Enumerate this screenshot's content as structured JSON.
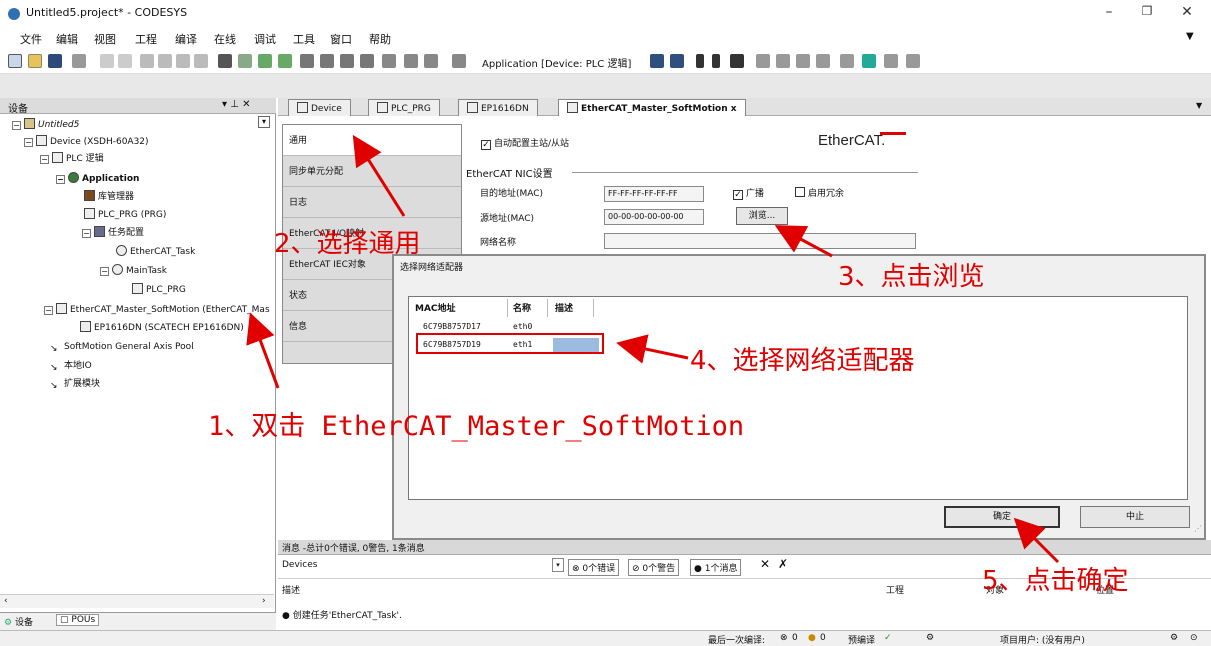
{
  "window": {
    "title": "Untitled5.project* - CODESYS",
    "minimize": "–",
    "restore": "❐",
    "close": "✕",
    "menu_overflow": "▼"
  },
  "menubar": {
    "items": [
      "文件",
      "编辑",
      "视图",
      "工程",
      "编译",
      "在线",
      "调试",
      "工具",
      "窗口",
      "帮助"
    ]
  },
  "toolbar": {
    "application_label": "Application [Device: PLC 逻辑]"
  },
  "left_panel": {
    "title": "设备",
    "controls": "▾ ⊥ ✕",
    "tree": [
      {
        "label": "Untitled5"
      },
      {
        "label": "Device (XSDH-60A32)"
      },
      {
        "label": "PLC 逻辑"
      },
      {
        "label": "Application"
      },
      {
        "label": "库管理器"
      },
      {
        "label": "PLC_PRG (PRG)"
      },
      {
        "label": "任务配置"
      },
      {
        "label": "EtherCAT_Task"
      },
      {
        "label": "MainTask"
      },
      {
        "label": "PLC_PRG"
      },
      {
        "label": "EtherCAT_Master_SoftMotion (EtherCAT_Mas"
      },
      {
        "label": "EP1616DN (SCATECH EP1616DN)"
      },
      {
        "label": "SoftMotion General Axis Pool"
      },
      {
        "label": "本地IO"
      },
      {
        "label": "扩展模块"
      }
    ],
    "bottom_tabs": [
      "设备",
      "POUs"
    ]
  },
  "editor": {
    "tabs": [
      "Device",
      "PLC_PRG",
      "EP1616DN",
      "EtherCAT_Master_SoftMotion"
    ],
    "tab_close": "x",
    "nav_items": [
      "通用",
      "同步单元分配",
      "日志",
      "EtherCAT I/O映射",
      "EtherCAT IEC对象",
      "状态",
      "信息"
    ],
    "auto_config": "自动配置主站/从站",
    "ethercat_logo": "EtherCAT.",
    "nic_section": "EtherCAT NIC设置",
    "dest_mac_label": "目的地址(MAC)",
    "dest_mac_value": "FF-FF-FF-FF-FF-FF",
    "broadcast_label": "广播",
    "redundancy_label": "启用冗余",
    "src_mac_label": "源地址(MAC)",
    "src_mac_value": "00-00-00-00-00-00",
    "browse_button": "浏览...",
    "network_name_label": "网络名称"
  },
  "dialog": {
    "title": "选择网络适配器",
    "columns": [
      "MAC地址",
      "名称",
      "描述"
    ],
    "rows": [
      {
        "mac": "6C79B8757D17",
        "name": "eth0",
        "desc": ""
      },
      {
        "mac": "6C79B8757D19",
        "name": "eth1",
        "desc": ""
      }
    ],
    "ok_button": "确定",
    "cancel_button": "中止"
  },
  "messages": {
    "header": "消息 -总计0个错误, 0警告, 1条消息",
    "source": "Devices",
    "errors": "0个错误",
    "warnings": "0个警告",
    "infos": "1个消息",
    "col_desc": "描述",
    "col_project": "工程",
    "col_object": "对象",
    "col_position": "位置",
    "row_text": "创建任务'EtherCAT_Task'."
  },
  "statusbar": {
    "last_build": "最后一次编译:",
    "err_count": "0",
    "warn_count": "0",
    "precompile": "预编译",
    "precompile_mark": "✓",
    "project_user": "项目用户: (没有用户)"
  },
  "annotations": {
    "step1": "1、双击 EtherCAT_Master_SoftMotion",
    "step2": "2、选择通用",
    "step3": "3、点击浏览",
    "step4": "4、选择网络适配器",
    "step5": "5、点击确定"
  },
  "colors": {
    "annotation_red": "#e00000",
    "app_blue": "#2f6fb3"
  }
}
